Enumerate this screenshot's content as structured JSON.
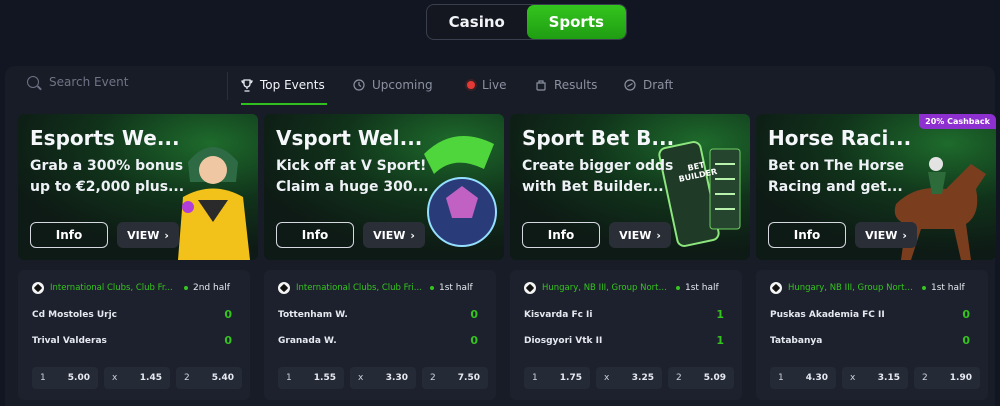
{
  "toggle": {
    "casino": "Casino",
    "sports": "Sports"
  },
  "search": {
    "placeholder": "Search Event"
  },
  "tabs": [
    {
      "label": "Top Events",
      "icon": "trophy-icon"
    },
    {
      "label": "Upcoming",
      "icon": "clock-icon"
    },
    {
      "label": "Live",
      "icon": "live-dot-icon"
    },
    {
      "label": "Results",
      "icon": "results-icon"
    },
    {
      "label": "Draft",
      "icon": "draft-icon"
    }
  ],
  "promos": [
    {
      "title": "Esports We...",
      "desc": "Grab a 300% bonus\nup to €2,000 plus...",
      "info": "Info",
      "view": "VIEW"
    },
    {
      "title": "Vsport Wel...",
      "desc": "Kick off at V Sport!\nClaim a huge 300...",
      "info": "Info",
      "view": "VIEW"
    },
    {
      "title": "Sport Bet B...",
      "desc": "Create bigger odds\nwith Bet Builder...",
      "info": "Info",
      "view": "VIEW",
      "art_text": "BET BUILDER"
    },
    {
      "title": "Horse Raci...",
      "desc": "Bet on The Horse\nRacing and get...",
      "info": "Info",
      "view": "VIEW",
      "badge": "20% Cashback"
    }
  ],
  "matches": [
    {
      "league": "International Clubs, Club Fr...",
      "status": "2nd half",
      "home": "Cd Mostoles Urjc",
      "home_score": "0",
      "away": "Trival Valderas",
      "away_score": "0",
      "odds": [
        {
          "label": "1",
          "value": "5.00"
        },
        {
          "label": "x",
          "value": "1.45"
        },
        {
          "label": "2",
          "value": "5.40"
        }
      ]
    },
    {
      "league": "International Clubs, Club Fri...",
      "status": "1st half",
      "home": "Tottenham W.",
      "home_score": "0",
      "away": "Granada W.",
      "away_score": "0",
      "odds": [
        {
          "label": "1",
          "value": "1.55"
        },
        {
          "label": "x",
          "value": "3.30"
        },
        {
          "label": "2",
          "value": "7.50"
        }
      ]
    },
    {
      "league": "Hungary, NB III, Group North ...",
      "status": "1st half",
      "home": "Kisvarda Fc Ii",
      "home_score": "1",
      "away": "Diosgyori Vtk II",
      "away_score": "1",
      "odds": [
        {
          "label": "1",
          "value": "1.75"
        },
        {
          "label": "x",
          "value": "3.25"
        },
        {
          "label": "2",
          "value": "5.09"
        }
      ]
    },
    {
      "league": "Hungary, NB III, Group North ...",
      "status": "1st half",
      "home": "Puskas Akademia FC II",
      "home_score": "0",
      "away": "Tatabanya",
      "away_score": "0",
      "odds": [
        {
          "label": "1",
          "value": "4.30"
        },
        {
          "label": "x",
          "value": "3.15"
        },
        {
          "label": "2",
          "value": "1.90"
        }
      ]
    }
  ],
  "colors": {
    "accent": "#2fbf1f",
    "background": "#121522",
    "panel": "#181c27",
    "badge": "#8e2fd0",
    "live": "#e53935"
  }
}
